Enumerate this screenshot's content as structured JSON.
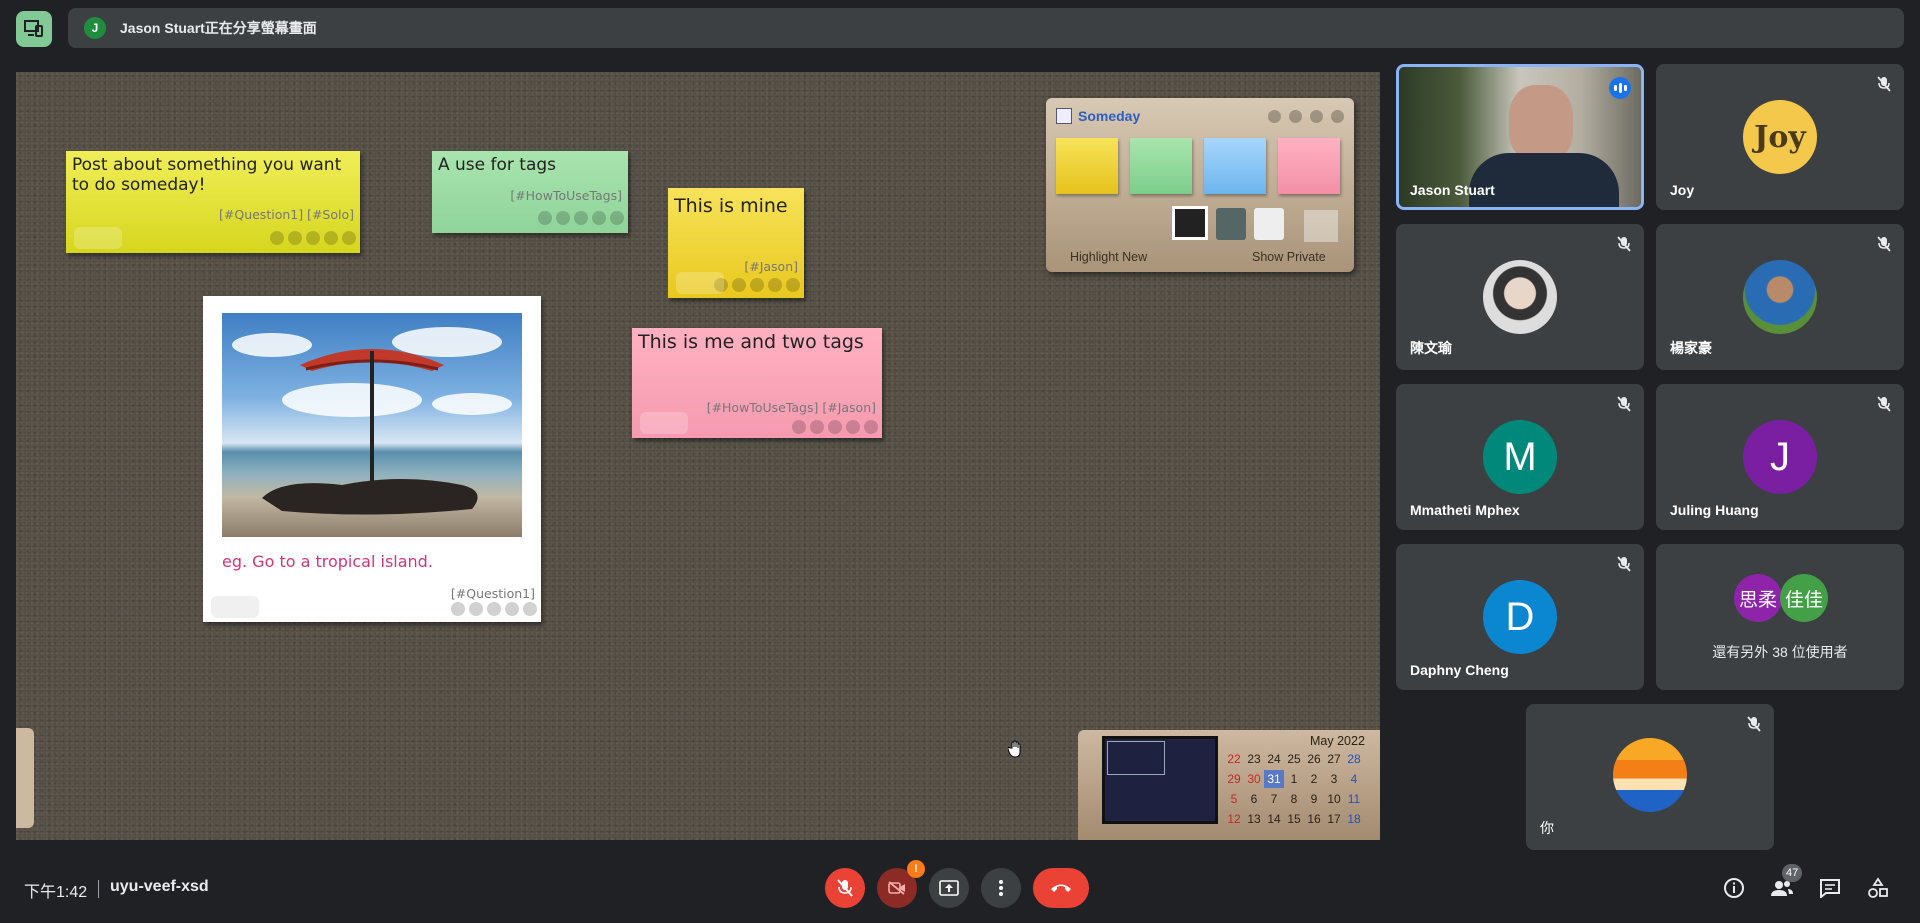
{
  "banner": {
    "avatar_letter": "J",
    "text": "Jason Stuart正在分享螢幕畫面"
  },
  "board": {
    "notes": [
      {
        "text": "Post about something you want to do someday!",
        "tags": "[#Question1] [#Solo]"
      },
      {
        "text": "A use for tags",
        "tags": "[#HowToUseTags]"
      },
      {
        "text": "This is mine",
        "tags": "[#Jason]"
      },
      {
        "text": "This is me and two tags",
        "tags": "[#HowToUseTags] [#Jason]"
      }
    ],
    "photo_note": {
      "caption": "eg. Go to a tropical island.",
      "tags": "[#Question1]"
    },
    "someday": {
      "title": "Someday",
      "highlight_new": "Highlight New",
      "show_private": "Show Private"
    },
    "calendar": {
      "month": "May 2022",
      "days": [
        "22",
        "23",
        "24",
        "25",
        "26",
        "27",
        "28",
        "29",
        "30",
        "31",
        "1",
        "2",
        "3",
        "4",
        "5",
        "6",
        "7",
        "8",
        "9",
        "10",
        "11",
        "12",
        "13",
        "14",
        "15",
        "16",
        "17",
        "18"
      ]
    }
  },
  "participants": [
    {
      "name": "Jason Stuart"
    },
    {
      "name": "Joy",
      "avatar_text": "Joy"
    },
    {
      "name": "陳文瑜"
    },
    {
      "name": "楊家豪"
    },
    {
      "name": "Mmatheti Mphex",
      "initial": "M"
    },
    {
      "name": "Juling Huang",
      "initial": "J"
    },
    {
      "name": "Daphny Cheng",
      "initial": "D"
    },
    {
      "name": "還有另外 38 位使用者",
      "chip1": "思柔",
      "chip2": "佳佳"
    },
    {
      "name": "你"
    }
  ],
  "bottom": {
    "time": "下午1:42",
    "meeting_code": "uyu-veef-xsd",
    "camera_badge": "!",
    "people_count": "47"
  },
  "colors": {
    "accent": "#8ab4f8",
    "danger": "#ea4335",
    "tile": "#3c4043"
  }
}
